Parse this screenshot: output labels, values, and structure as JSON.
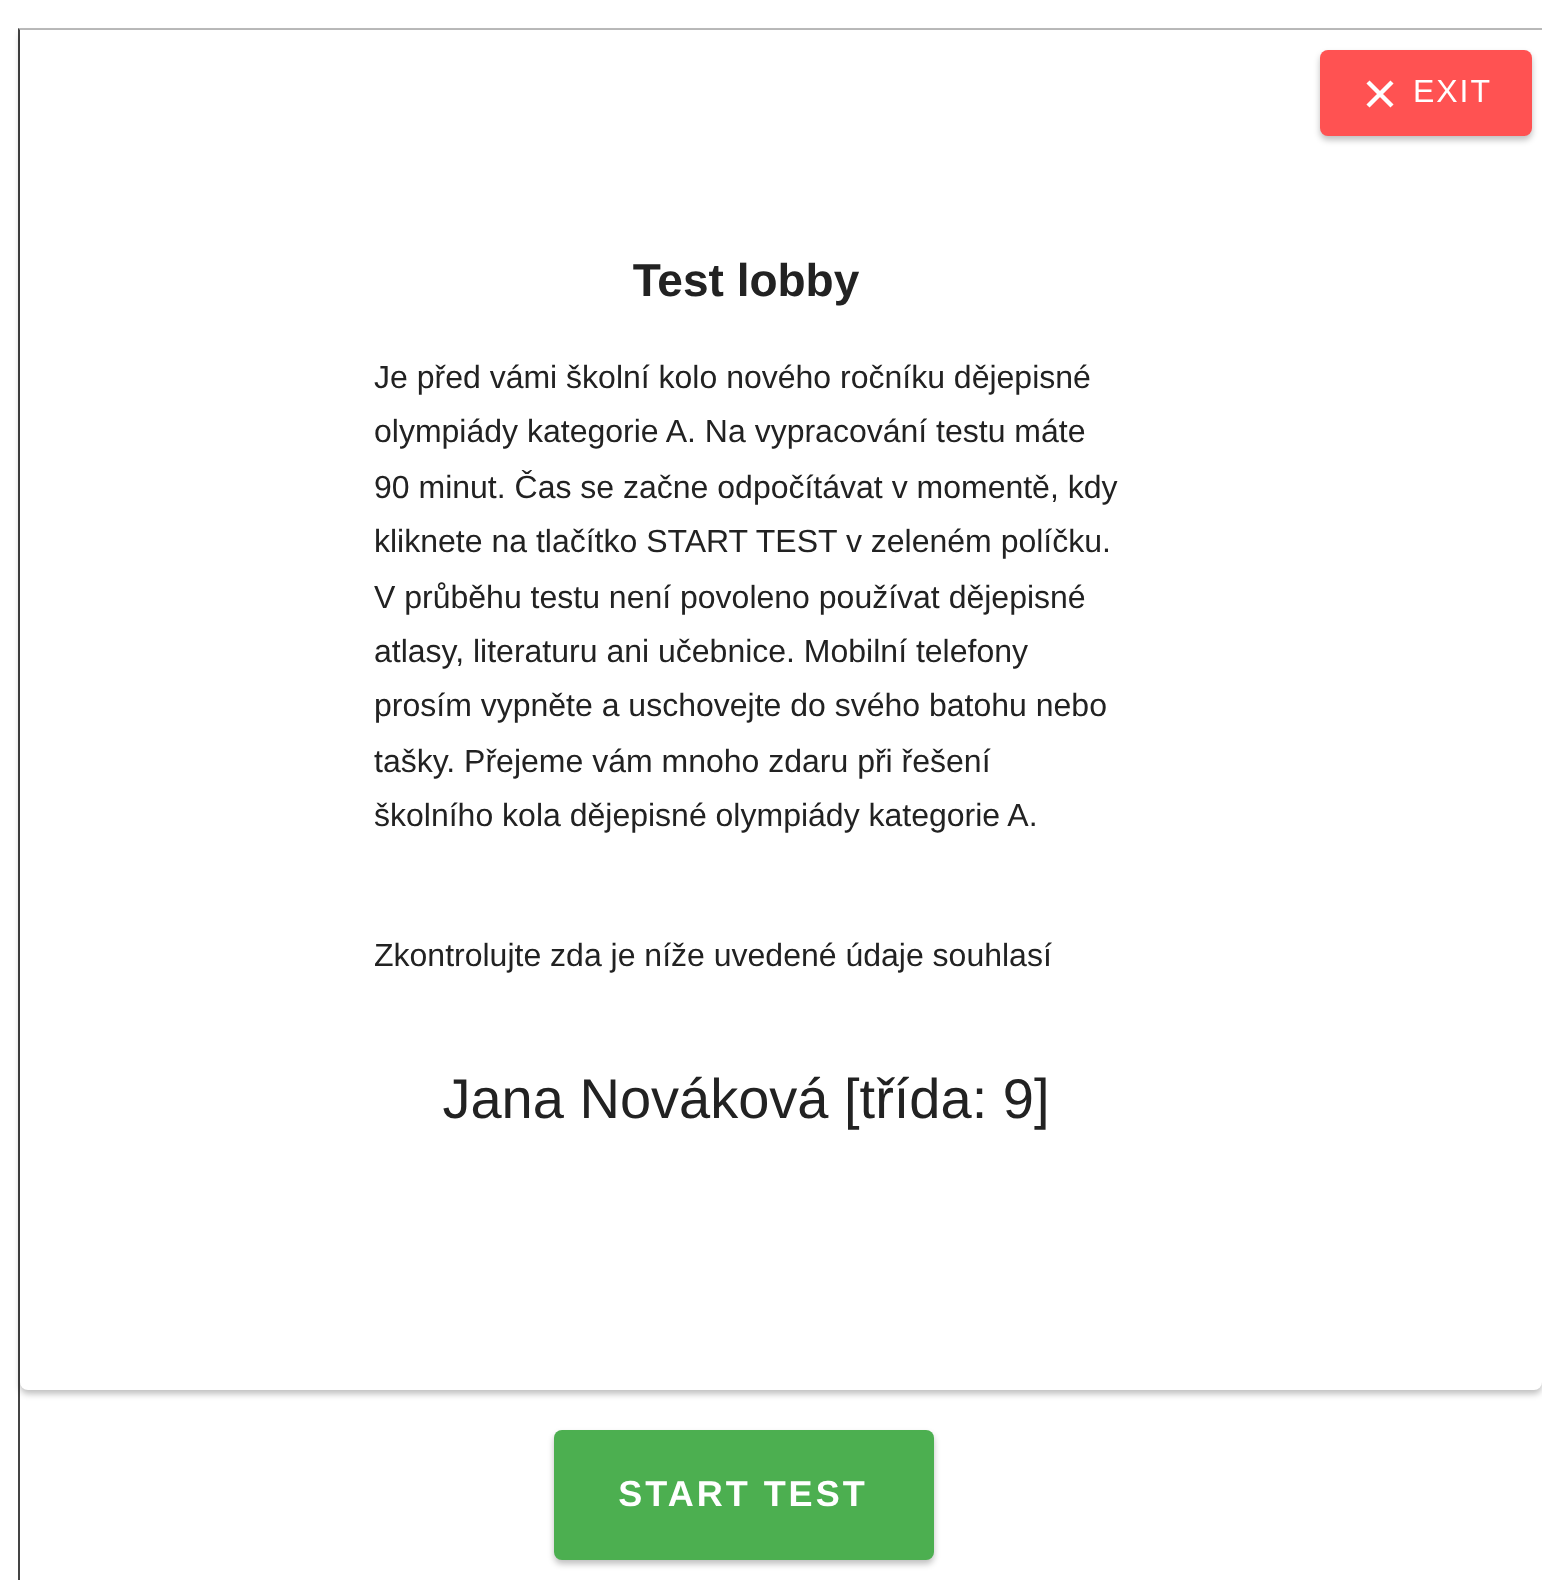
{
  "exit_button": {
    "label": "EXIT"
  },
  "lobby": {
    "title": "Test lobby",
    "instructions": "Je před vámi školní kolo nového ročníku dějepisné olympiády kategorie A. Na vypracování testu máte 90 minut. Čas se začne odpočítávat v momentě, kdy kliknete na tlačítko START TEST v zeleném políčku. V průběhu testu není povoleno používat dějepisné atlasy, literaturu ani učebnice. Mobilní telefony prosím vypněte a uschovejte do svého batohu nebo tašky. Přejeme vám mnoho zdaru při řešení školního kola dějepisné olympiády kategorie A.",
    "check_prompt": "Zkontrolujte zda je níže uvedené údaje souhlasí",
    "student": "Jana Nováková [třída: 9]"
  },
  "start_button": {
    "label": "START TEST"
  }
}
